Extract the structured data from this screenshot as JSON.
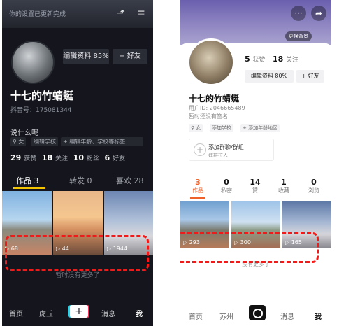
{
  "left_phone": {
    "top_tip": "你的设置已更新完成",
    "edit_profile": "编辑资料 85%",
    "add_friend": "+ 好友",
    "username": "十七的竹蜻蜓",
    "douyin_id": "抖音号：175081344",
    "bio": "说什么呢",
    "tags": [
      "♀ 女",
      "编辑学校",
      "+ 编辑年龄、学校等标签"
    ],
    "stats": [
      {
        "value": "29",
        "label": "获赞"
      },
      {
        "value": "18",
        "label": "关注"
      },
      {
        "value": "10",
        "label": "粉丝"
      },
      {
        "value": "6",
        "label": "好友"
      }
    ],
    "tabs": [
      "作品 3",
      "转发 0",
      "喜欢 28"
    ],
    "videos": [
      {
        "plays": "▷ 68"
      },
      {
        "plays": "▷ 44"
      },
      {
        "plays": "▷ 1944"
      }
    ],
    "no_more": "暂时没有更多了",
    "nav": [
      "首页",
      "虎丘",
      "+",
      "消息",
      "我"
    ]
  },
  "right_phone": {
    "bg_button": "更换背景",
    "stats": [
      {
        "value": "5",
        "label": "获赞"
      },
      {
        "value": "18",
        "label": "关注"
      }
    ],
    "edit_profile": "编辑资料 80%",
    "add_friend": "+ 好友",
    "username": "十七的竹蜻蜓",
    "id_line": "用户ID: 2046665489",
    "signature": "暂时还没有签名",
    "tags": [
      "♀ 女",
      "添加学校",
      "+ 添加年龄地区"
    ],
    "group_title": "添加群聊/群组",
    "group_sub": "建群拉人",
    "tabs": [
      {
        "value": "3",
        "label": "作品"
      },
      {
        "value": "0",
        "label": "私密"
      },
      {
        "value": "14",
        "label": "赞"
      },
      {
        "value": "1",
        "label": "收藏"
      },
      {
        "value": "0",
        "label": "浏览"
      }
    ],
    "videos": [
      {
        "plays": "▷ 293"
      },
      {
        "plays": "▷ 300"
      },
      {
        "plays": "▷ 165"
      }
    ],
    "no_more": "没有更多了",
    "nav": [
      "首页",
      "苏州",
      "消息",
      "我"
    ]
  },
  "colors": {
    "annotation": "#ef1b1b",
    "left_accent": "#f5c400",
    "right_accent": "#f0612a"
  }
}
